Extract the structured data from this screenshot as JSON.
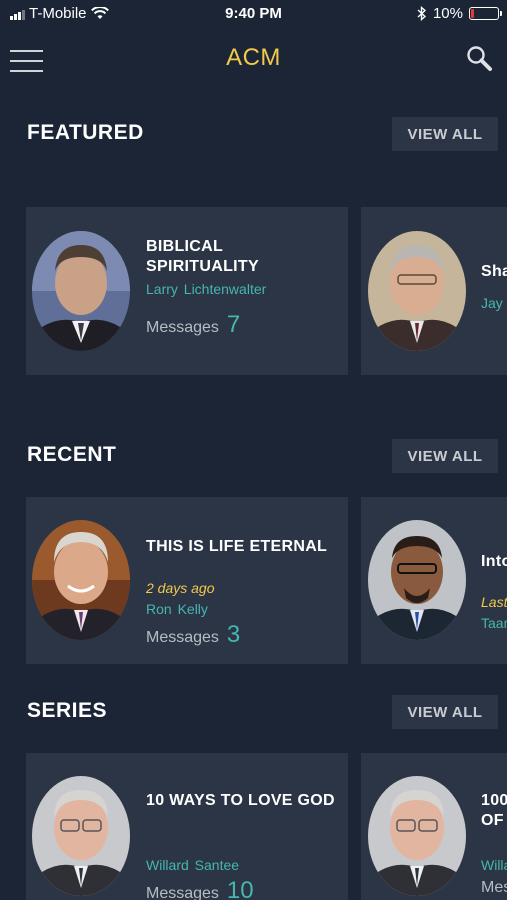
{
  "status_bar": {
    "carrier": "T-Mobile",
    "time": "9:40 PM",
    "battery": "10%",
    "battery_level": 0.1,
    "battery_color": "#e53935"
  },
  "nav": {
    "title": "ACM",
    "title_color": "#f2c94c",
    "menu_icon": "hamburger-icon",
    "search_icon": "search-icon"
  },
  "sections": [
    {
      "title": "FEATURED",
      "view_all": "VIEW ALL",
      "cards": [
        {
          "title": "BIBLICAL SPIRITUALITY",
          "author": "Larry Lichtenwalter",
          "date": "",
          "count_label": "Messages",
          "count": "7"
        },
        {
          "title": "Sha",
          "author": "Jay",
          "date": "",
          "count_label": "",
          "count": ""
        }
      ]
    },
    {
      "title": "RECENT",
      "view_all": "VIEW ALL",
      "cards": [
        {
          "title": "THIS IS LIFE ETERNAL",
          "author": "Ron  Kelly",
          "date": "2 days ago",
          "count_label": "Messages",
          "count": "3"
        },
        {
          "title": "Into",
          "author": "Taar",
          "date": "Last",
          "count_label": "",
          "count": ""
        }
      ]
    },
    {
      "title": "SERIES",
      "view_all": "VIEW ALL",
      "cards": [
        {
          "title": "10 WAYS TO LOVE GOD",
          "author": "Willard Santee",
          "date": "",
          "count_label": "Messages",
          "count": "10"
        },
        {
          "title": "100 OF",
          "author": "Willa",
          "date": "",
          "count_label": "Mes",
          "count": ""
        }
      ]
    }
  ],
  "colors": {
    "background": "#1b2536",
    "card": "#2b3545",
    "accent_teal": "#46b6ae",
    "accent_gold": "#f2c94c"
  }
}
